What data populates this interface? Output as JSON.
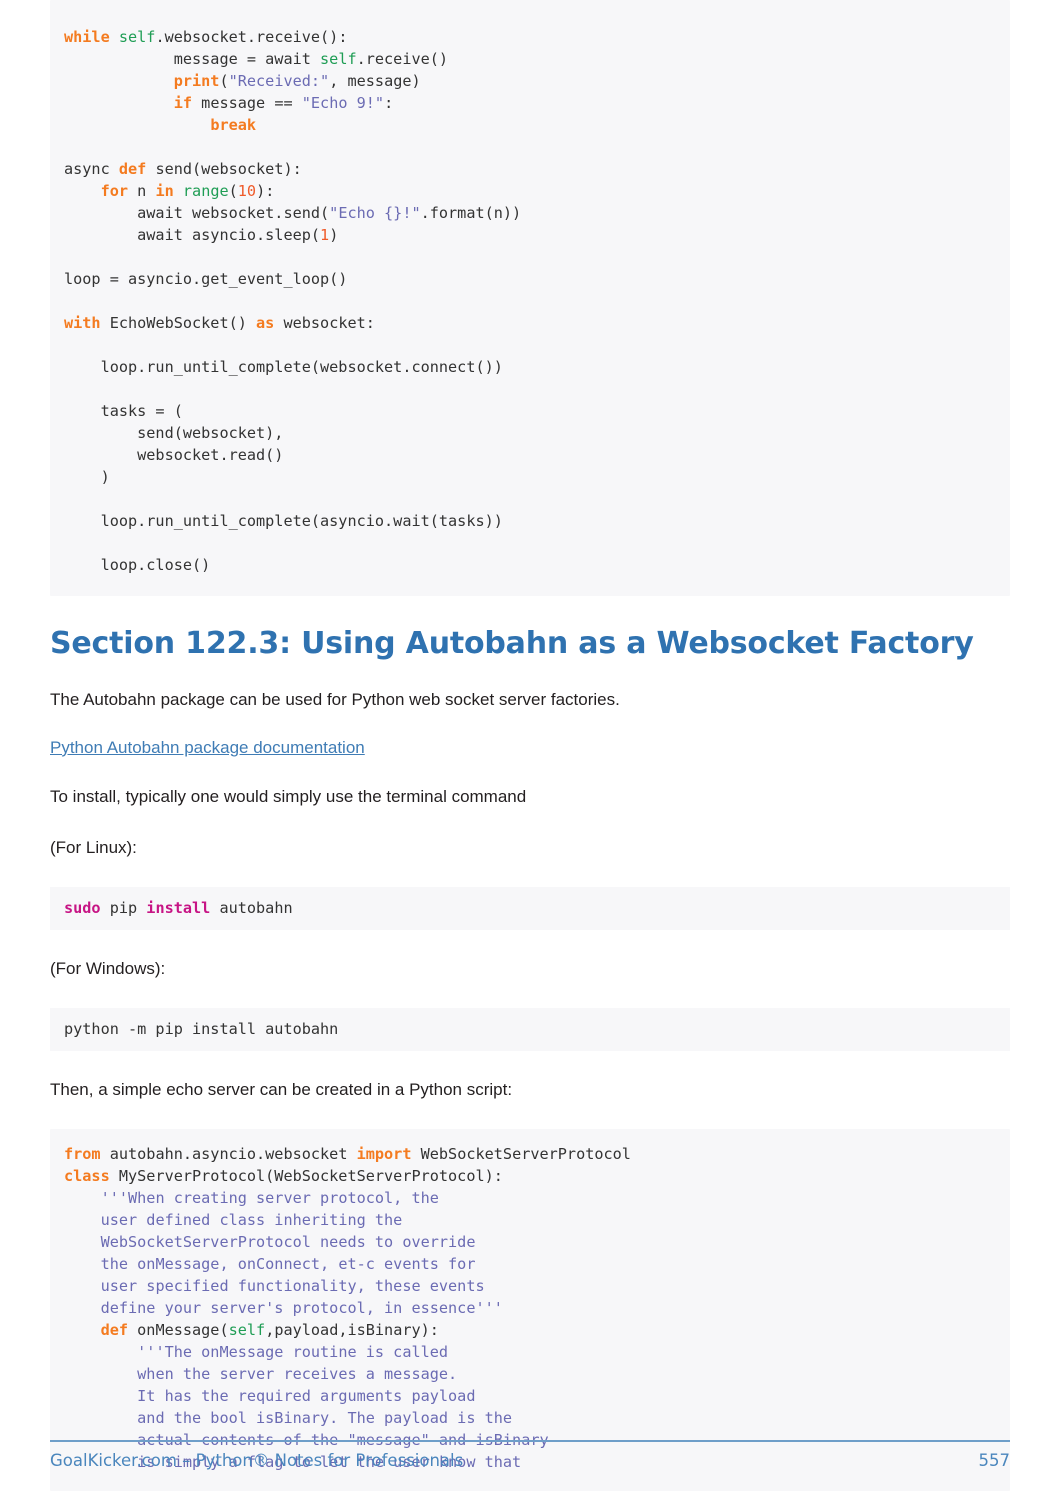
{
  "page": {
    "number": "557",
    "footer_text": "GoalKicker.com – Python® Notes for Professionals"
  },
  "code_block_top": {
    "language": "python",
    "lines": [
      "        while self.websocket.receive():",
      "            message = await self.receive()",
      "            print(\"Received:\", message)",
      "            if message == \"Echo 9!\":",
      "                break",
      "",
      "async def send(websocket):",
      "    for n in range(10):",
      "        await websocket.send(\"Echo {}!\".format(n))",
      "        await asyncio.sleep(1)",
      "",
      "loop = asyncio.get_event_loop()",
      "",
      "with EchoWebSocket() as websocket:",
      "",
      "    loop.run_until_complete(websocket.connect())",
      "",
      "    tasks = (",
      "        send(websocket),",
      "        websocket.read()",
      "    )",
      "",
      "    loop.run_until_complete(asyncio.wait(tasks))",
      "",
      "    loop.close()"
    ]
  },
  "section": {
    "title": "Section 122.3: Using Autobahn as a Websocket Factory",
    "intro_paragraph": "The Autobahn package can be used for Python web socket server factories.",
    "link_label": "Python Autobahn package documentation",
    "install_paragraph": "To install, typically one would simply use the terminal command",
    "linux_label": "(For Linux):",
    "windows_label": "(For Windows):",
    "script_paragraph": "Then, a simple echo server can be created in a Python script:"
  },
  "linux_command": {
    "keyword_sudo": "sudo",
    "pip": " pip ",
    "keyword_install": "install",
    "package": " autobahn"
  },
  "windows_command": {
    "text": "python -m pip install autobahn"
  },
  "code_block_bottom": {
    "language": "python",
    "lines": [
      "from autobahn.asyncio.websocket import WebSocketServerProtocol",
      "class MyServerProtocol(WebSocketServerProtocol):",
      "    '''When creating server protocol, the",
      "    user defined class inheriting the",
      "    WebSocketServerProtocol needs to override",
      "    the onMessage, onConnect, et-c events for",
      "    user specified functionality, these events",
      "    define your server's protocol, in essence'''",
      "    def onMessage(self,payload,isBinary):",
      "        '''The onMessage routine is called",
      "        when the server receives a message.",
      "        It has the required arguments payload",
      "        and the bool isBinary. The payload is the",
      "        actual contents of the \"message\" and isBinary",
      "        is simply a flag to let the user know that"
    ]
  },
  "colors": {
    "heading": "#2f72b0",
    "link": "#3f7cb5",
    "footer": "#4a86bd",
    "code_bg": "#f7f7f9",
    "keyword": "#f47b20",
    "builtin": "#1f9d55",
    "string": "#6b6bb3",
    "number": "#ef5a29",
    "shell_keyword": "#c71585"
  }
}
